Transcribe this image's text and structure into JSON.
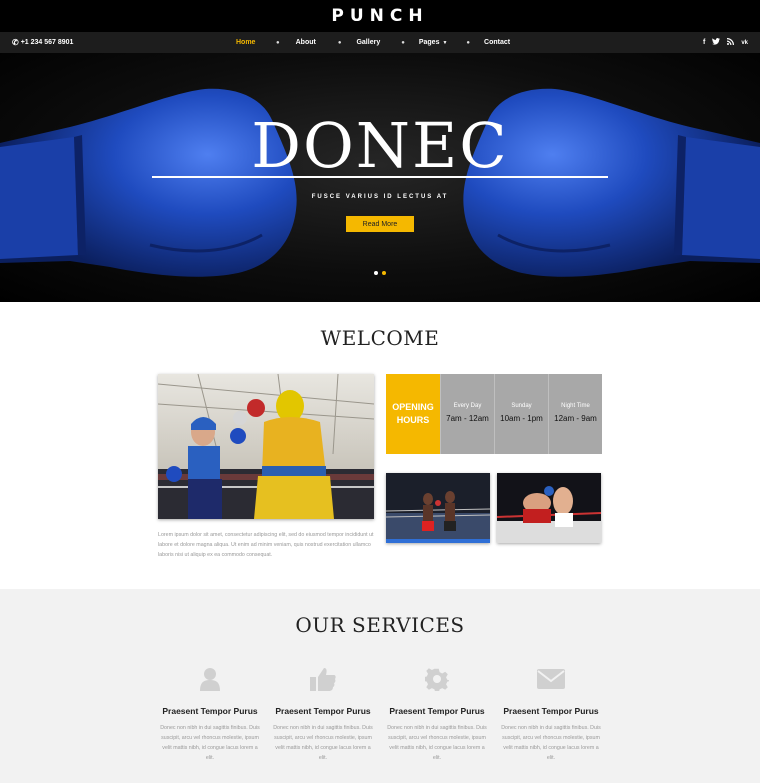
{
  "brand": "PUNCH",
  "header": {
    "phone": "+1 234 567 8901",
    "nav": [
      {
        "label": "Home",
        "active": true
      },
      {
        "label": "About"
      },
      {
        "label": "Gallery"
      },
      {
        "label": "Pages"
      },
      {
        "label": "Contact"
      }
    ],
    "separator": "●",
    "social": [
      "f",
      "t",
      "rss",
      "vk"
    ]
  },
  "hero": {
    "title": "DONEC",
    "subtitle": "FUSCE VARIUS ID LECTUS AT",
    "button": "Read More",
    "slides": 2,
    "active_slide": 2
  },
  "welcome": {
    "title": "WELCOME",
    "text": "Lorem ipsum dolor sit amet, consectetur adipiscing elit, sed do eiusmod tempor incididunt ut labore et dolore magna aliqua. Ut enim ad minim veniam, quis nostrud exercitation ullamco laboris nisi ut aliquip ex ea commodo consequat.",
    "hours": {
      "label_line1": "OPENING",
      "label_line2": "HOURS",
      "columns": [
        {
          "day": "Every Day",
          "time": "7am - 12am"
        },
        {
          "day": "Sunday",
          "time": "10am - 1pm"
        },
        {
          "day": "Night Time",
          "time": "12am - 9am"
        }
      ]
    }
  },
  "services": {
    "title": "OUR SERVICES",
    "items": [
      {
        "icon": "user-icon",
        "title": "Praesent Tempor Purus",
        "text": "Donec non nibh in dui sagittis finibus. Duis suscipit, arcu vel rhoncus molestie, ipsum velit mattis nibh, id congue lacus lorem a elit."
      },
      {
        "icon": "thumbs-up-icon",
        "title": "Praesent Tempor Purus",
        "text": "Donec non nibh in dui sagittis finibus. Duis suscipit, arcu vel rhoncus molestie, ipsum velit mattis nibh, id congue lacus lorem a elit."
      },
      {
        "icon": "gear-icon",
        "title": "Praesent Tempor Purus",
        "text": "Donec non nibh in dui sagittis finibus. Duis suscipit, arcu vel rhoncus molestie, ipsum velit mattis nibh, id congue lacus lorem a elit."
      },
      {
        "icon": "envelope-icon",
        "title": "Praesent Tempor Purus",
        "text": "Donec non nibh in dui sagittis finibus. Duis suscipit, arcu vel rhoncus molestie, ipsum velit mattis nibh, id congue lacus lorem a elit."
      }
    ]
  },
  "colors": {
    "accent": "#f5b800",
    "glove": "#1f4bbf",
    "nav_bg": "#1d1d1d",
    "section_bg": "#f2f2f2"
  }
}
